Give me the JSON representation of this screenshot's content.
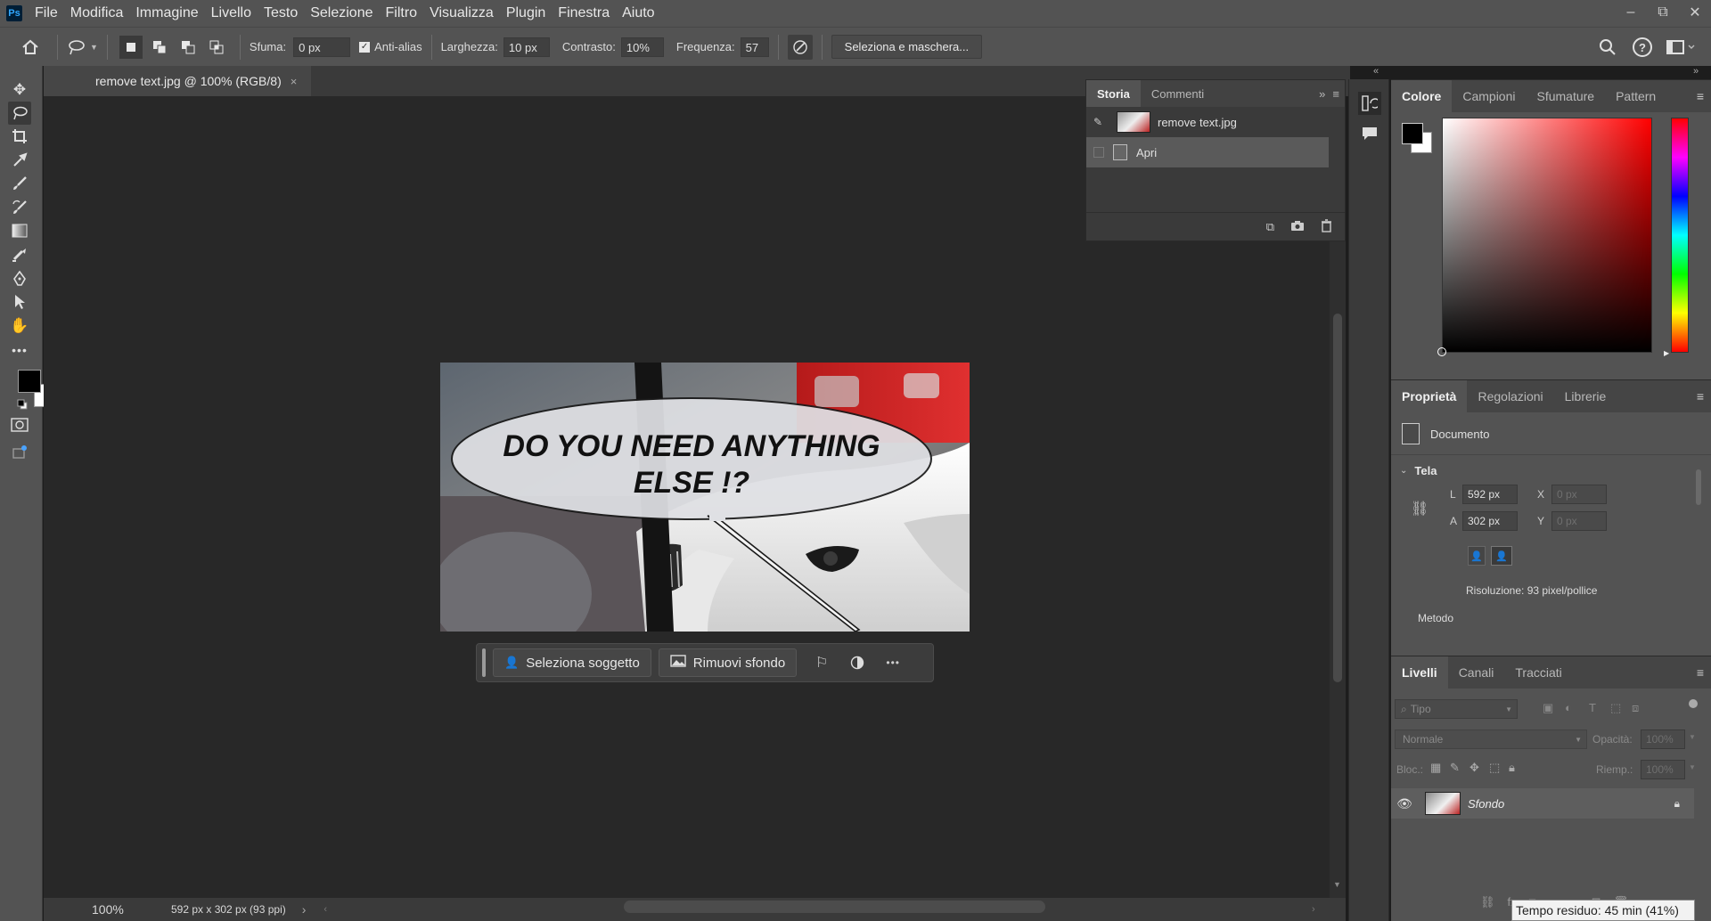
{
  "app": {
    "logo": "Ps"
  },
  "menu": [
    "File",
    "Modifica",
    "Immagine",
    "Livello",
    "Testo",
    "Selezione",
    "Filtro",
    "Visualizza",
    "Plugin",
    "Finestra",
    "Aiuto"
  ],
  "window_controls": {
    "minimize": "–",
    "restore": "⧉",
    "close": "✕"
  },
  "options": {
    "sfuma_label": "Sfuma:",
    "sfuma_value": "0 px",
    "antialias_label": "Anti-alias",
    "larghezza_label": "Larghezza:",
    "larghezza_value": "10 px",
    "contrasto_label": "Contrasto:",
    "contrasto_value": "10%",
    "frequenza_label": "Frequenza:",
    "frequenza_value": "57",
    "select_mask_button": "Seleziona e maschera..."
  },
  "document": {
    "tab_title": "remove text.jpg @ 100% (RGB/8)",
    "close": "×",
    "speech_text_line1": "DO YOU NEED ANYTHING",
    "speech_text_line2": "ELSE !?"
  },
  "taskbar": {
    "select_subject": "Seleziona soggetto",
    "remove_bg": "Rimuovi sfondo",
    "more": "•••"
  },
  "status": {
    "zoom": "100%",
    "doc_info": "592 px x 302 px (93 ppi)",
    "arrow": "›"
  },
  "history": {
    "tabs": [
      "Storia",
      "Commenti"
    ],
    "snapshot_label": "remove text.jpg",
    "steps": [
      "Apri"
    ]
  },
  "color_panel": {
    "tabs": [
      "Colore",
      "Campioni",
      "Sfumature",
      "Pattern"
    ],
    "foreground": "#000000",
    "background": "#ffffff",
    "hue": "#ff0000"
  },
  "properties": {
    "tabs": [
      "Proprietà",
      "Regolazioni",
      "Librerie"
    ],
    "doc_label": "Documento",
    "section": "Tela",
    "w_label": "L",
    "w_value": "592 px",
    "h_label": "A",
    "h_value": "302 px",
    "x_label": "X",
    "x_placeholder": "0 px",
    "y_label": "Y",
    "y_placeholder": "0 px",
    "resolution": "Risoluzione: 93 pixel/pollice",
    "method": "Metodo"
  },
  "layers": {
    "tabs": [
      "Livelli",
      "Canali",
      "Tracciati"
    ],
    "filter_placeholder": "Tipo",
    "blend_mode": "Normale",
    "opacity_label": "Opacità:",
    "opacity_value": "100%",
    "lock_label": "Bloc.:",
    "fill_label": "Riemp.:",
    "fill_value": "100%",
    "layer_name": "Sfondo"
  },
  "tooltip": "Tempo residuo: 45 min (41%)"
}
